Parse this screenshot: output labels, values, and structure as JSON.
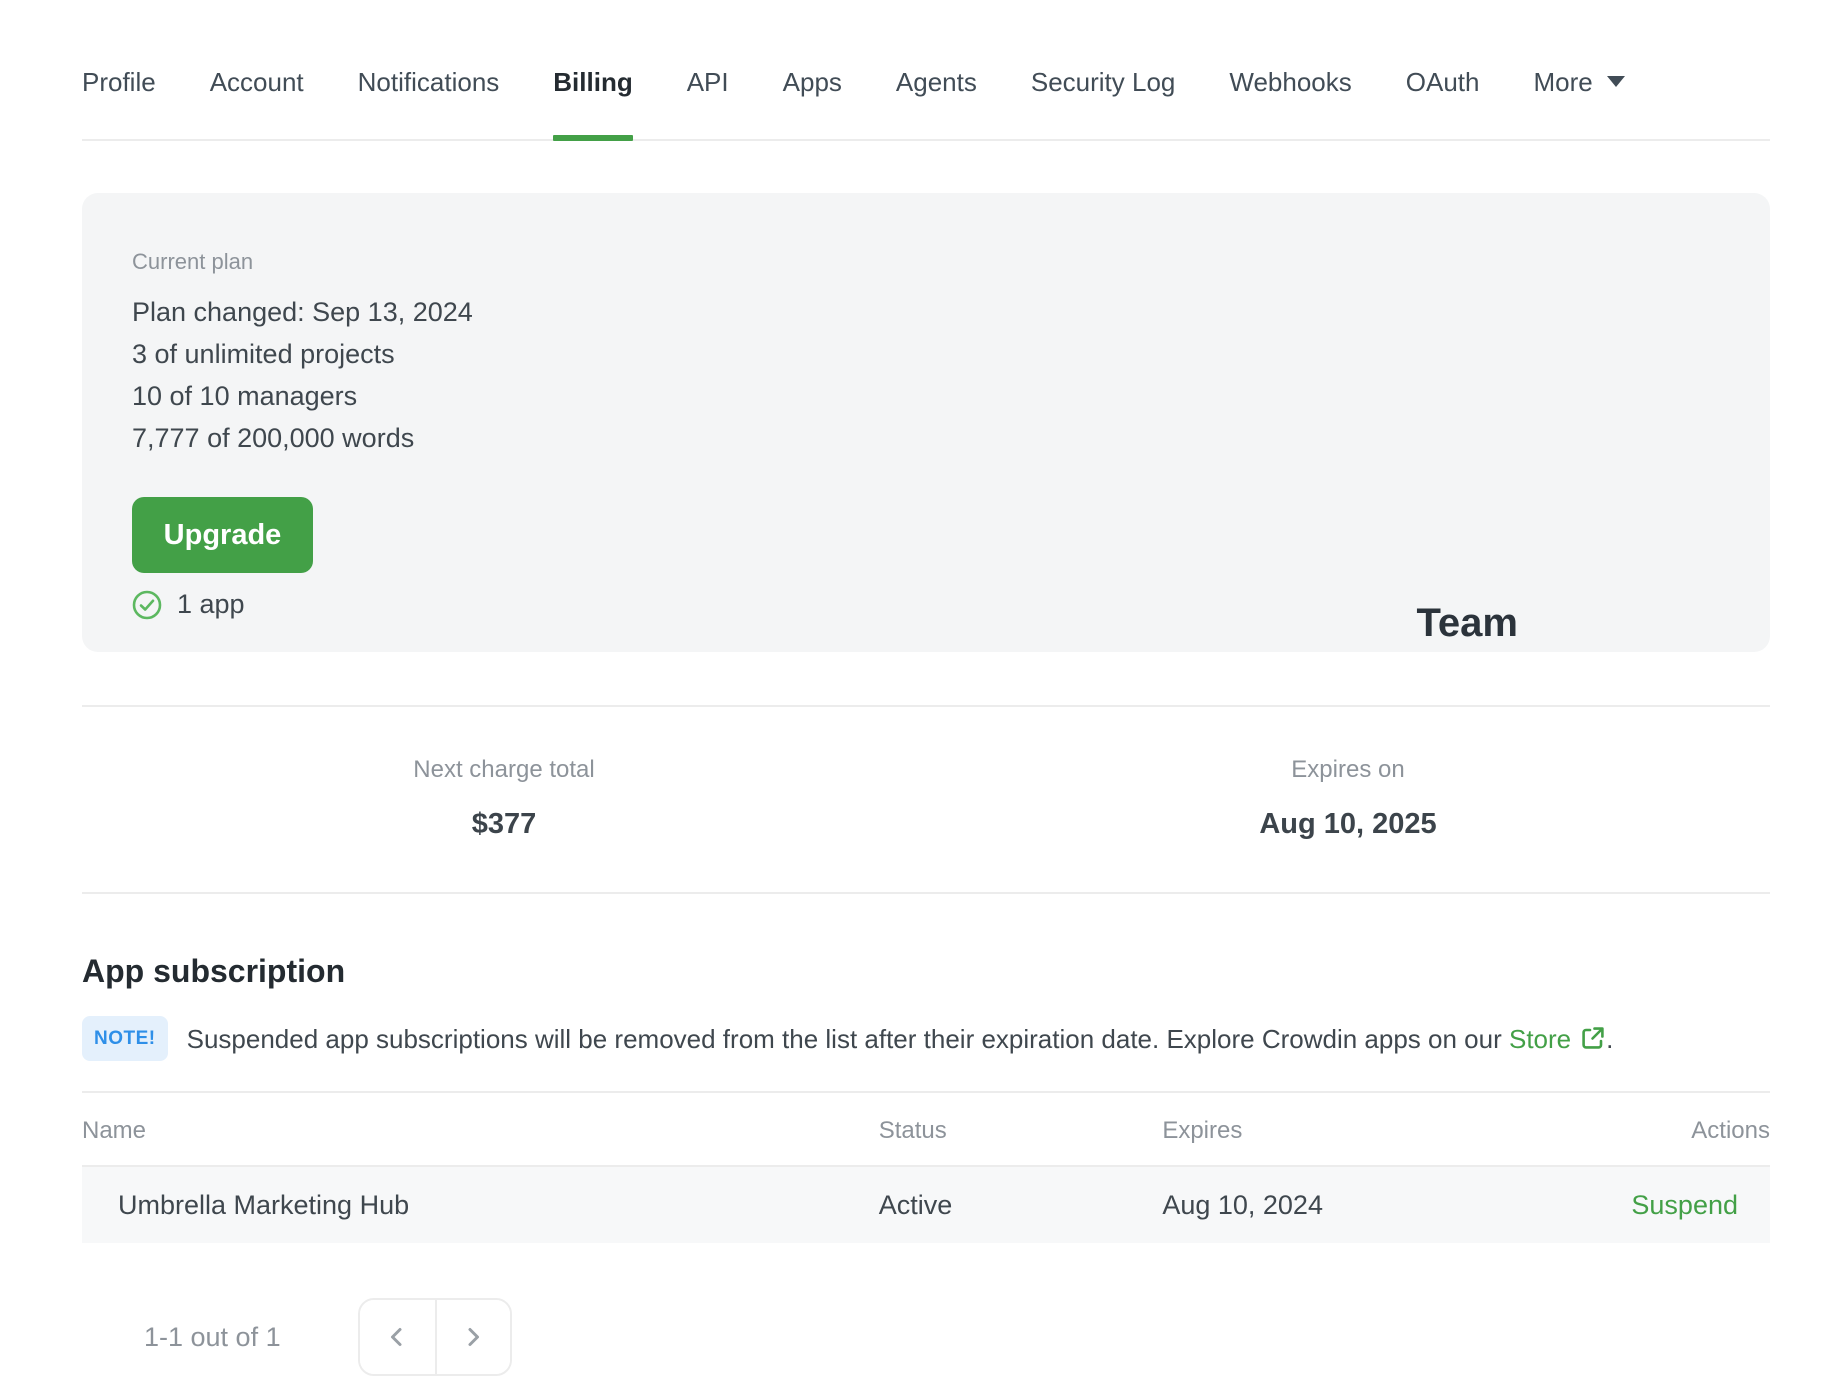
{
  "nav": {
    "tabs": [
      {
        "label": "Profile",
        "active": false
      },
      {
        "label": "Account",
        "active": false
      },
      {
        "label": "Notifications",
        "active": false
      },
      {
        "label": "Billing",
        "active": true
      },
      {
        "label": "API",
        "active": false
      },
      {
        "label": "Apps",
        "active": false
      },
      {
        "label": "Agents",
        "active": false
      },
      {
        "label": "Security Log",
        "active": false
      },
      {
        "label": "Webhooks",
        "active": false
      },
      {
        "label": "OAuth",
        "active": false
      },
      {
        "label": "More",
        "active": false,
        "has_caret": true
      }
    ]
  },
  "plan_card": {
    "label": "Current plan",
    "lines": [
      "Plan changed: Sep 13, 2024",
      "3 of unlimited projects",
      "10 of 10 managers",
      "7,777 of 200,000 words"
    ],
    "upgrade_label": "Upgrade",
    "apps_summary": "1 app",
    "plan_name": "Team"
  },
  "billing_summary": {
    "next_charge_label": "Next charge total",
    "next_charge_value": "$377",
    "expires_label": "Expires on",
    "expires_value": "Aug 10, 2025"
  },
  "app_subscription": {
    "title": "App subscription",
    "note_badge": "NOTE!",
    "note_before_link": "Suspended app subscriptions will be removed from the list after their expiration date. Explore Crowdin apps on our ",
    "note_link": "Store",
    "note_after_link": ".",
    "table": {
      "headers": [
        "Name",
        "Status",
        "Expires",
        "Actions"
      ],
      "rows": [
        {
          "name": "Umbrella Marketing Hub",
          "status": "Active",
          "expires": "Aug 10, 2024",
          "action": "Suspend"
        }
      ]
    },
    "pagination": {
      "summary": "1-1 out of 1"
    }
  },
  "colors": {
    "accent_green": "#43a047",
    "note_blue": "#2e8fe8",
    "note_bg": "#e4f0fc",
    "card_bg": "#f4f5f6",
    "muted_text": "#8d939a",
    "dark_text": "#3f474e"
  }
}
